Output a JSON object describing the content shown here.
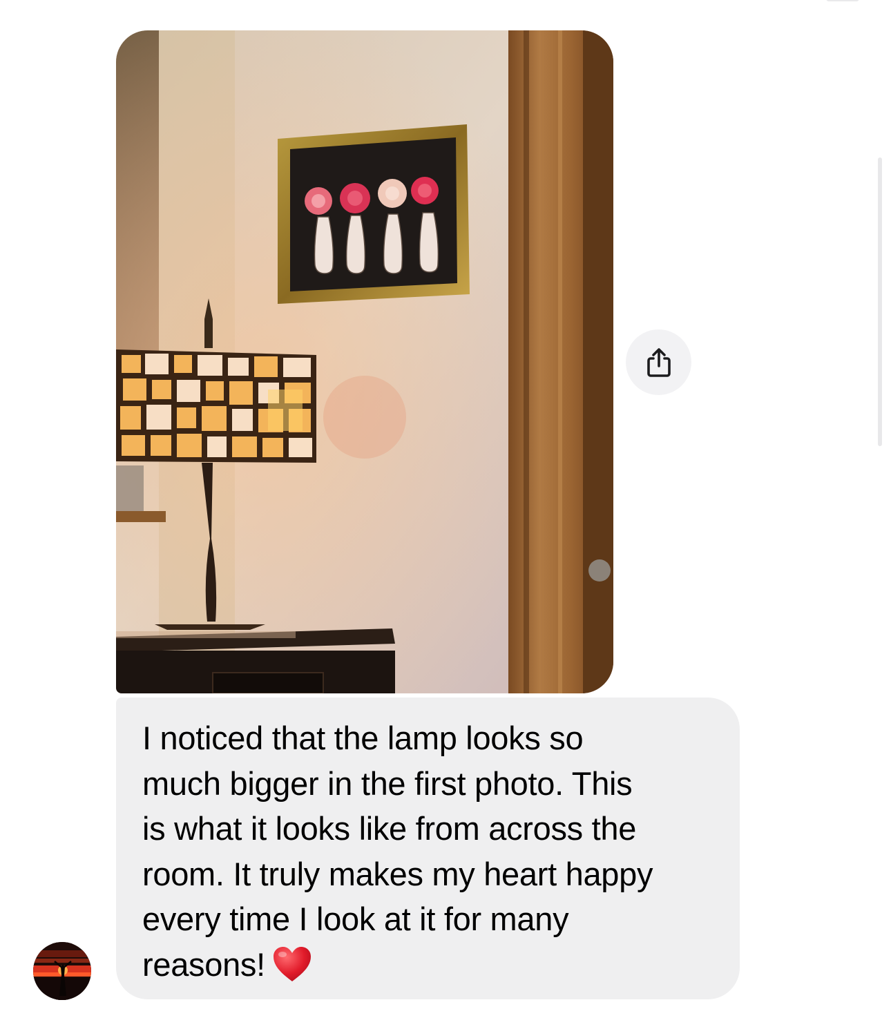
{
  "message": {
    "lines": [
      "I noticed that the lamp looks so",
      "much bigger in the first photo. This",
      "is what it looks like from across the",
      "room. It truly makes my heart happy",
      "every time I look at it for many",
      "reasons!"
    ],
    "emoji": "red-heart"
  },
  "attachment": {
    "kind": "photo",
    "subject": "stained glass table lamp and framed flower painting"
  },
  "share_button": {
    "icon": "share-icon"
  },
  "sender": {
    "avatar": "avatar-sunset-silhouette"
  },
  "colors": {
    "incoming_bubble": "#efeff0",
    "share_button_bg": "#f2f2f4",
    "text": "#000000",
    "heart": "#e11b2a"
  }
}
